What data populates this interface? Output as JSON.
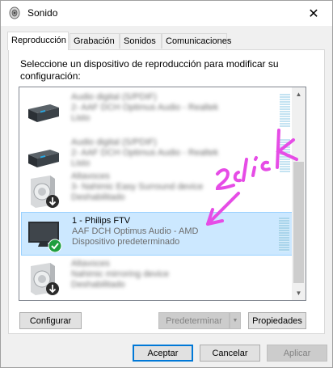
{
  "window": {
    "title": "Sonido",
    "close_glyph": "✕"
  },
  "tabs": [
    {
      "label": "Reproducción",
      "active": true
    },
    {
      "label": "Grabación",
      "active": false
    },
    {
      "label": "Sonidos",
      "active": false
    },
    {
      "label": "Comunicaciones",
      "active": false
    }
  ],
  "instruction": "Seleccione un dispositivo de reproducción para modificar su configuración:",
  "devices": [
    {
      "name": "Audio digital (S/PDIF)",
      "line2": "2- AAF DCH Optimus Audio - Realtek",
      "line3": "Listo",
      "icon": "digital-audio-receiver-icon",
      "blurred": true
    },
    {
      "name": "Audio digital (S/PDIF)",
      "line2": "2- AAF DCH Optimus Audio - Realtek",
      "line3": "Listo",
      "icon": "digital-audio-receiver-icon",
      "blurred": true
    },
    {
      "name": "Altavoces",
      "line2": "3- Nahimic Easy Surround device",
      "line3": "Deshabilitado",
      "icon": "speaker-disabled-icon",
      "blurred": true
    },
    {
      "name": "1 - Philips FTV",
      "line2": "AAF DCH Optimus Audio - AMD",
      "line3": "Dispositivo predeterminado",
      "icon": "monitor-default-icon",
      "blurred": false,
      "selected": true
    },
    {
      "name": "Altavoces",
      "line2": "Nahimic mirroring device",
      "line3": "Deshabilitado",
      "icon": "speaker-disabled-icon",
      "blurred": true
    }
  ],
  "annotation": {
    "text": "2click",
    "color": "#e64ce6"
  },
  "buttons": {
    "configure": "Configurar",
    "set_default": "Predeterminar",
    "properties": "Propiedades",
    "accept": "Aceptar",
    "cancel": "Cancelar",
    "apply": "Aplicar"
  },
  "colors": {
    "selection": "#cce8ff",
    "selection_border": "#99d1ff",
    "accent": "#0078d7",
    "default_check": "#1e9e3e"
  }
}
